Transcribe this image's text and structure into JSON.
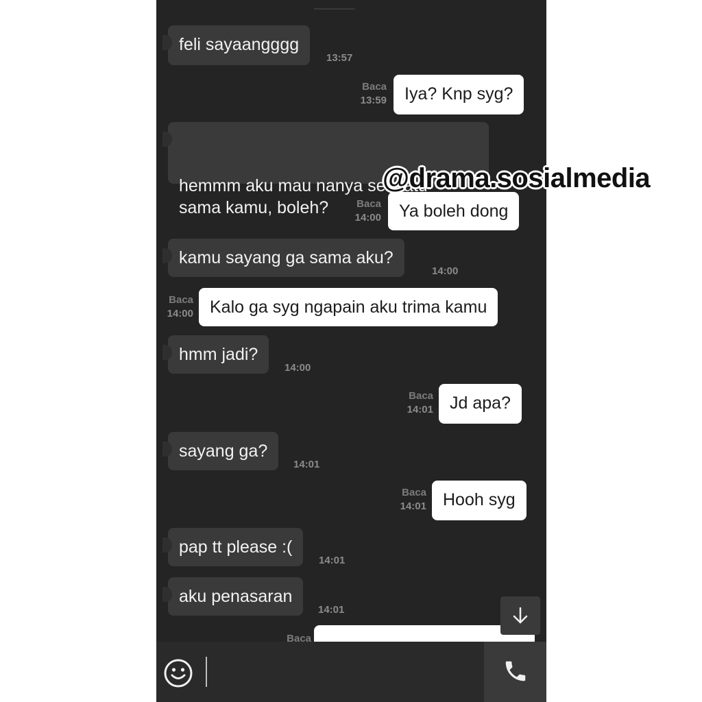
{
  "messages": [
    {
      "dir": "in",
      "text": "feli sayaangggg",
      "time": "13:57"
    },
    {
      "dir": "out",
      "text": "Iya? Knp syg?",
      "read": "Baca",
      "time": "13:59"
    },
    {
      "dir": "in",
      "text": "hemmm aku mau nanya sesuatu\nsama kamu, boleh?",
      "time": ""
    },
    {
      "dir": "out",
      "text": "Ya boleh dong",
      "read": "Baca",
      "time": "14:00"
    },
    {
      "dir": "in",
      "text": "kamu sayang ga sama aku?",
      "time": "14:00"
    },
    {
      "dir": "out",
      "text": "Kalo ga syg ngapain aku trima kamu",
      "read": "Baca",
      "time": "14:00"
    },
    {
      "dir": "in",
      "text": "hmm jadi?",
      "time": "14:00"
    },
    {
      "dir": "out",
      "text": "Jd apa?",
      "read": "Baca",
      "time": "14:01"
    },
    {
      "dir": "in",
      "text": "sayang ga?",
      "time": "14:01"
    },
    {
      "dir": "out",
      "text": "Hooh syg",
      "read": "Baca",
      "time": "14:01"
    },
    {
      "dir": "in",
      "text": "pap tt please :(",
      "time": "14:01"
    },
    {
      "dir": "in",
      "text": "aku penasaran",
      "time": "14:01"
    },
    {
      "dir": "out",
      "text": "",
      "read": "Baca",
      "time": ""
    }
  ],
  "watermark": "@drama.sosialmedia",
  "composer": {
    "emoji_icon": "smiley-icon",
    "call_icon": "phone-icon"
  },
  "scroll_icon": "arrow-down-icon",
  "colors": {
    "background": "#242424",
    "incoming": "#3a3a3a",
    "outgoing": "#ffffff"
  }
}
